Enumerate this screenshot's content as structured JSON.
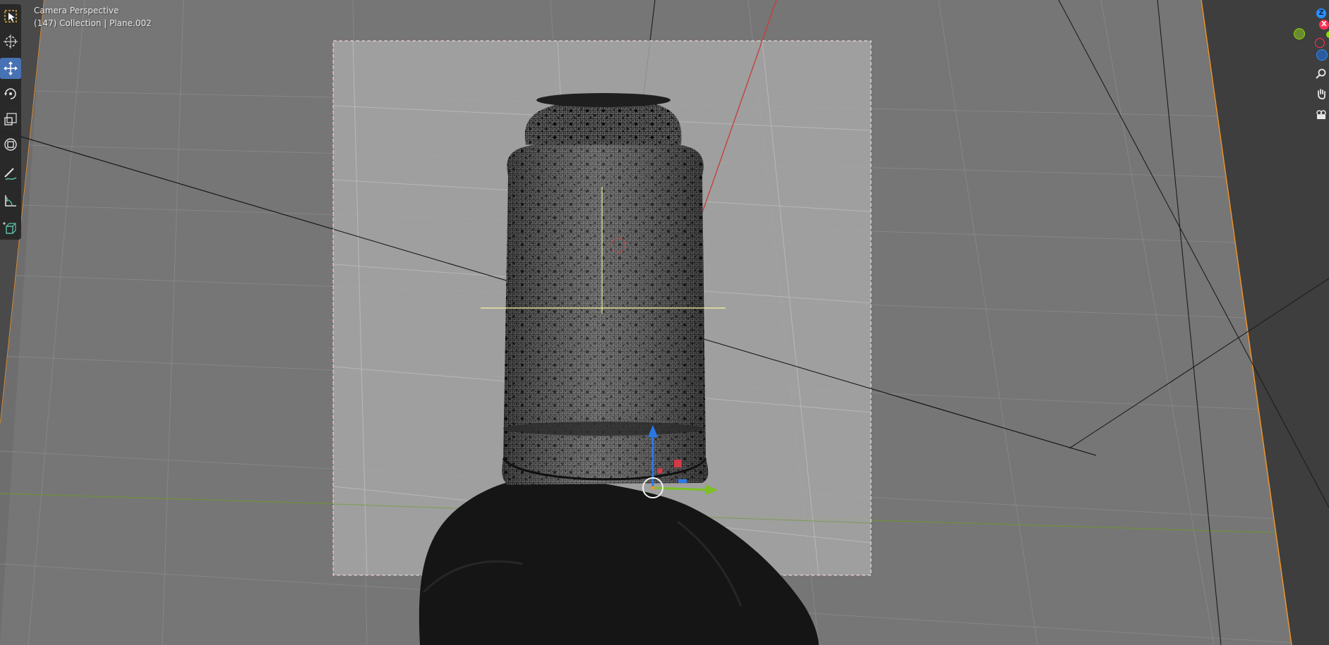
{
  "viewport": {
    "view_name": "Camera Perspective",
    "view_info": "(147) Collection | Plane.002"
  },
  "toolbar": {
    "tools": [
      {
        "name": "select-box-tool",
        "icon": "select-box-icon"
      },
      {
        "name": "cursor-tool",
        "icon": "cursor-icon"
      },
      {
        "name": "move-tool",
        "icon": "move-icon",
        "active": true
      },
      {
        "name": "rotate-tool",
        "icon": "rotate-icon"
      },
      {
        "name": "scale-tool",
        "icon": "scale-icon"
      },
      {
        "name": "transform-tool",
        "icon": "transform-icon"
      },
      {
        "name": "annotate-tool",
        "icon": "annotate-icon"
      },
      {
        "name": "measure-tool",
        "icon": "measure-icon"
      },
      {
        "name": "add-cube-tool",
        "icon": "add-cube-icon"
      }
    ]
  },
  "gizmo": {
    "z_label": "Z",
    "x_label": "X",
    "colors": {
      "x": "#ff3352",
      "y": "#8bdc00",
      "z": "#2890ff"
    }
  },
  "colors": {
    "viewport_bg": "#6e6e6e",
    "camera_frame_bg": "#a8a8a8",
    "toolbar_bg": "#262626",
    "active_tool": "#4772b3",
    "selection_orange": "#f0932b"
  }
}
